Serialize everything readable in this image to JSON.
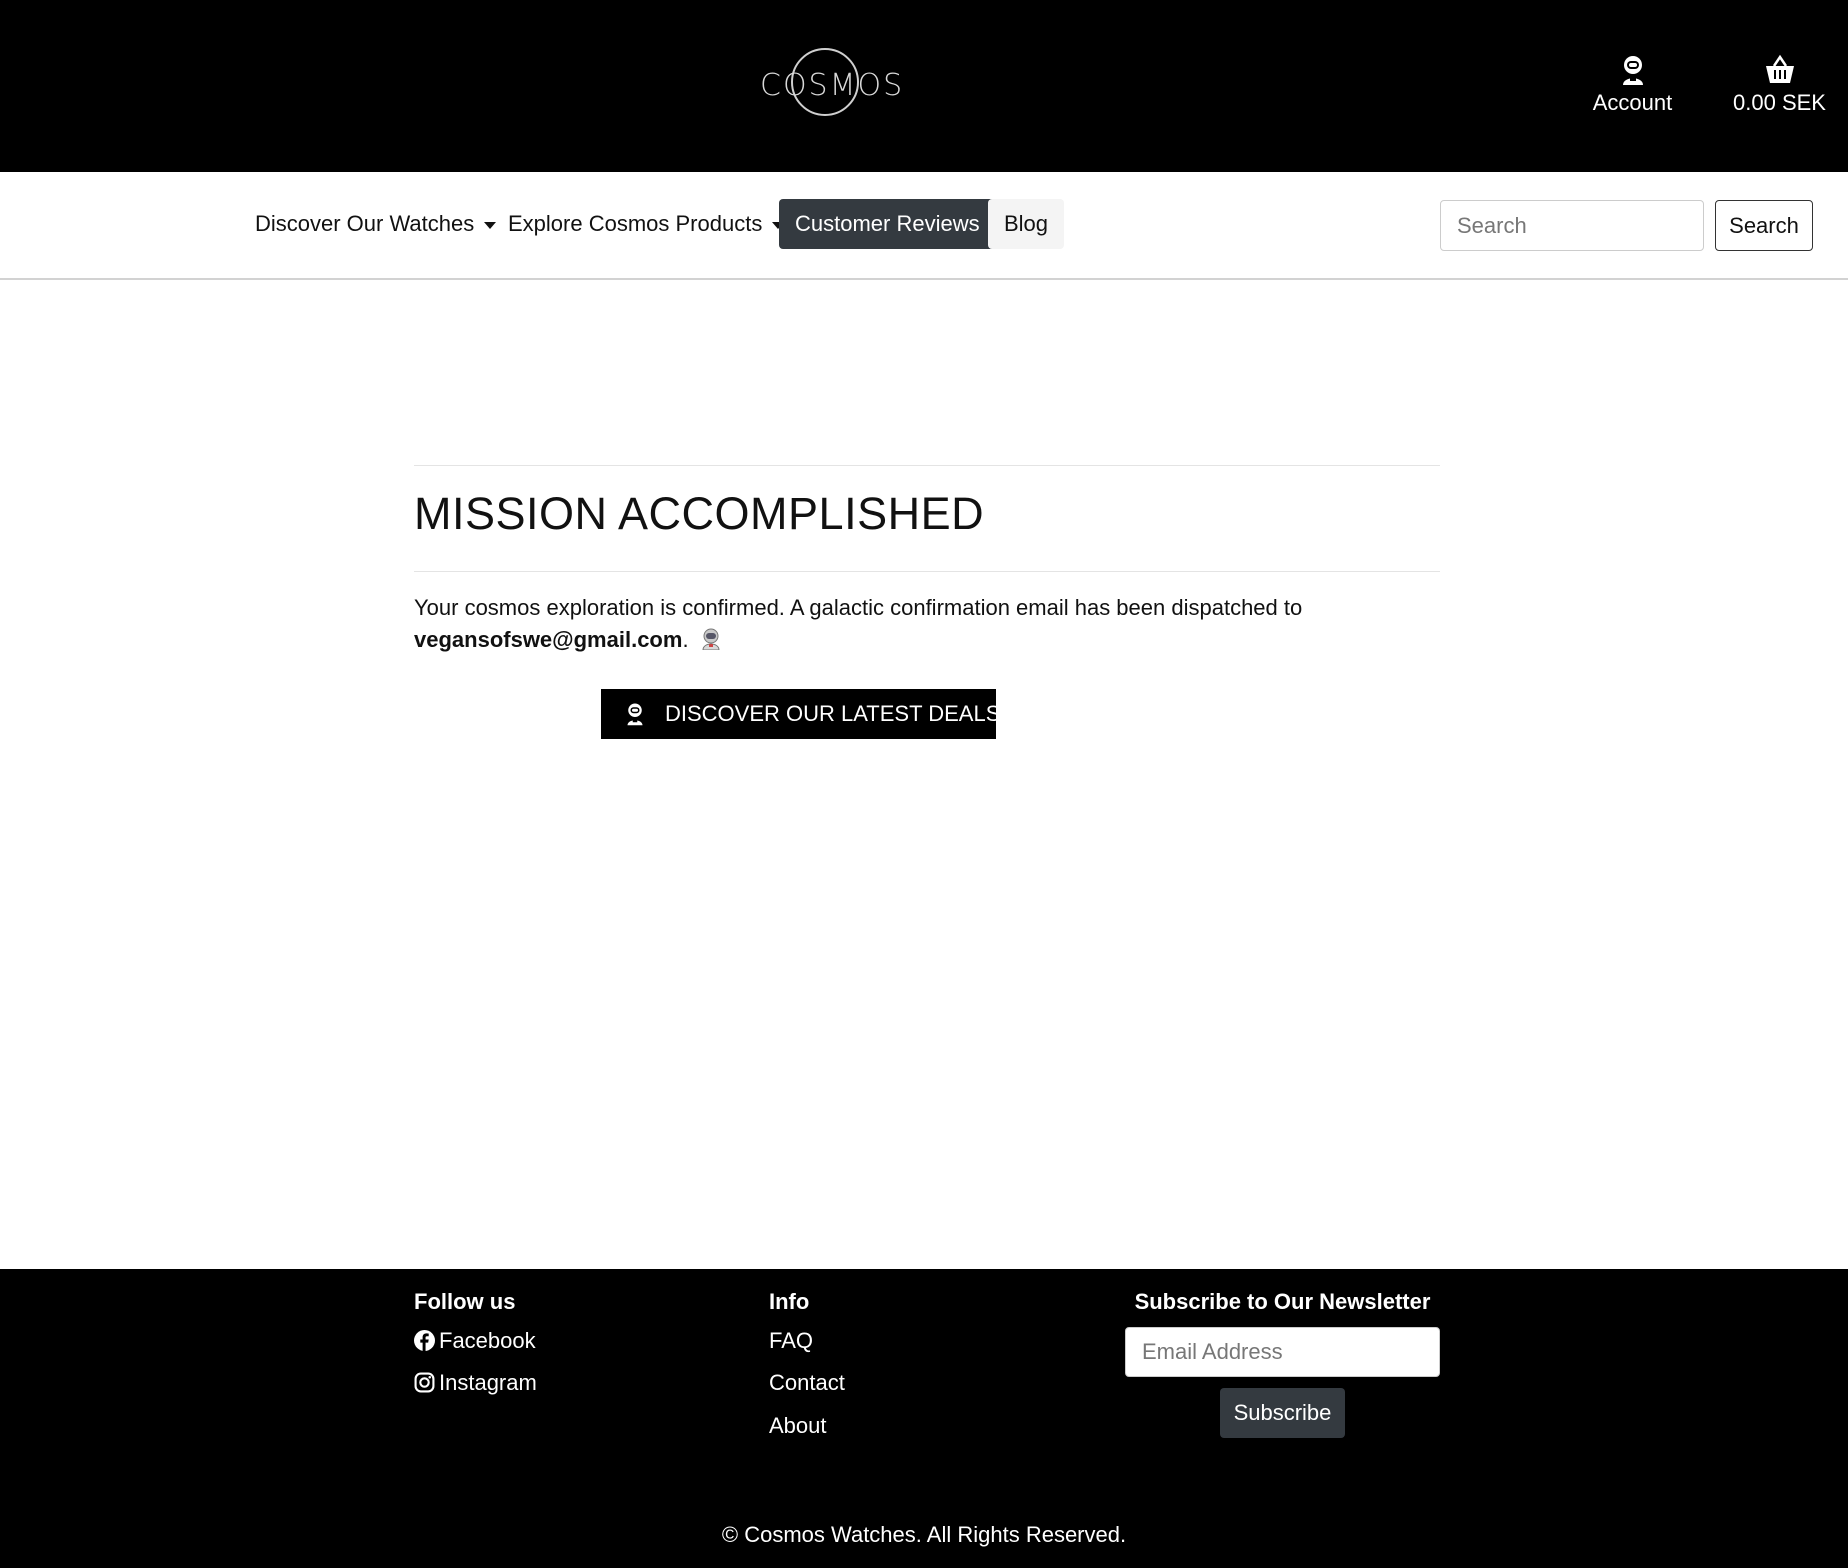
{
  "header": {
    "logo_text": "COSMOS",
    "account_label": "Account",
    "cart_total": "0.00 SEK"
  },
  "nav": {
    "items": [
      {
        "label": "Discover Our Watches",
        "dropdown": true
      },
      {
        "label": "Explore Cosmos Products",
        "dropdown": true
      },
      {
        "label": "Customer Reviews",
        "active": true
      },
      {
        "label": "Blog"
      }
    ],
    "search_placeholder": "Search",
    "search_button": "Search"
  },
  "main": {
    "title": "MISSION ACCOMPLISHED",
    "message_prefix": "Your cosmos exploration is confirmed. A galactic confirmation email has been dispatched to",
    "email": "vegansofswe@gmail.com",
    "message_suffix": ".",
    "cta_label": "DISCOVER OUR LATEST DEALS !"
  },
  "footer": {
    "follow_heading": "Follow us",
    "social": [
      {
        "label": "Facebook",
        "icon": "facebook-icon"
      },
      {
        "label": "Instagram",
        "icon": "instagram-icon"
      }
    ],
    "info_heading": "Info",
    "info_links": [
      "FAQ",
      "Contact",
      "About"
    ],
    "newsletter_heading": "Subscribe to Our Newsletter",
    "newsletter_placeholder": "Email Address",
    "subscribe_button": "Subscribe",
    "copyright": "© Cosmos Watches. All Rights Reserved."
  },
  "colors": {
    "header_bg": "#000000",
    "active_nav_bg": "#343a40",
    "cta_bg": "#000000",
    "subscribe_bg": "#343a40"
  }
}
